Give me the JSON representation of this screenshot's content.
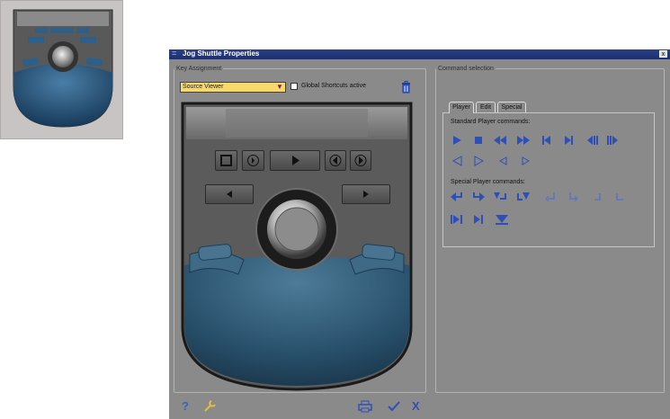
{
  "window": {
    "title": "Jog Shuttle Properties",
    "system_menu": "=",
    "close_label": "x"
  },
  "key_assignment": {
    "legend": "Key Assignment",
    "source": "Source Viewer",
    "source_arrow": "▼",
    "global_shortcuts_label": "Global Shortcuts active"
  },
  "command_selection": {
    "legend": "Command selection",
    "tabs": [
      "Player",
      "Edit",
      "Special"
    ],
    "standard_label": "Standard Player commands:",
    "special_label": "Special Player commands:",
    "standard_icons": [
      "play-icon",
      "stop-icon",
      "rewind-icon",
      "fast-forward-icon",
      "step-back-icon",
      "step-forward-icon",
      "shuttle-back-icon",
      "shuttle-forward-icon",
      "play-reverse-outline-icon",
      "play-outline-icon",
      "slow-back-icon",
      "slow-forward-icon"
    ],
    "special_icons": [
      "jump-in-left-icon",
      "jump-in-right-icon",
      "mark-in-down-icon",
      "mark-out-down-icon",
      "goto-in-icon",
      "goto-in-alt-icon",
      "goto-out-icon",
      "goto-out-alt-icon",
      "play-in-out-icon",
      "play-to-out-icon",
      "play-around-icon"
    ]
  },
  "footer": {
    "help": "?",
    "cancel": "X"
  },
  "colors": {
    "title_bar": "#1c2f6e",
    "icon_blue": "#2f4fb6",
    "select_bg": "#f7d96a",
    "device_blue": "#2a5a7e"
  }
}
